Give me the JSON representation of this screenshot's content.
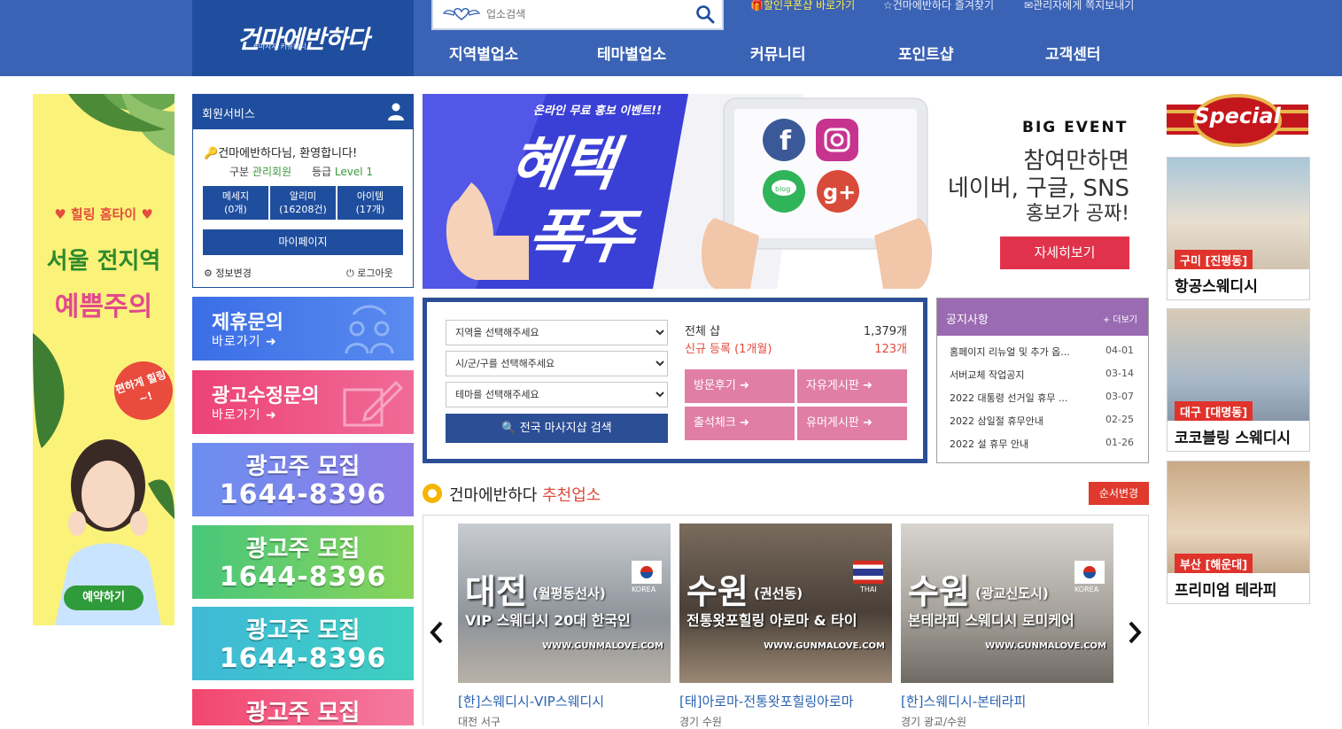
{
  "header": {
    "logo_text": "건마에반하다",
    "logo_sub": "#마사지 커뮤니티",
    "search_placeholder": "업소검색",
    "top_links": [
      "할인쿠폰샵 바로가기",
      "건마에반하다 즐겨찾기",
      "관리자에게 쪽지보내기"
    ],
    "nav": [
      "지역별업소",
      "테마별업소",
      "커뮤니티",
      "포인트샵",
      "고객센터"
    ]
  },
  "left_ad": {
    "line1": "♥ 힐링 홈타이 ♥",
    "line2": "서울 전지역",
    "line3": "예쁨주의",
    "bubble": "편하게 힐링~!",
    "button": "예약하기"
  },
  "member": {
    "title": "회원서비스",
    "welcome": "건마에반하다님, 환영합니다!",
    "grade_label": "구분",
    "grade_value": "관리회원",
    "level_label": "등급",
    "level_value": "Level 1",
    "stats": [
      {
        "label": "메세지",
        "value": "(0개)"
      },
      {
        "label": "알리미",
        "value": "(16208건)"
      },
      {
        "label": "아이템",
        "value": "(17개)"
      }
    ],
    "mypage": "마이페이지",
    "edit": "정보변경",
    "logout": "로그아웃"
  },
  "cta": [
    {
      "title": "제휴문의",
      "sub": "바로가기 ➜",
      "color": "#3c6fe0"
    },
    {
      "title": "광고수정문의",
      "sub": "바로가기 ➜",
      "color": "#ee4a82"
    }
  ],
  "recruit": [
    {
      "t1": "광고주 모집",
      "t2": "1644-8396"
    },
    {
      "t1": "광고주 모집",
      "t2": "1644-8396"
    },
    {
      "t1": "광고주 모집",
      "t2": "1644-8396"
    },
    {
      "t1": "광고주 모집",
      "t2": ""
    }
  ],
  "event": {
    "tag": "온라인 무료 홍보 이벤트!!",
    "big1": "혜택",
    "big2": "폭주",
    "head": "BIG EVENT",
    "l1": "참여만하면",
    "l2": "네이버, 구글, SNS",
    "l3": "홍보가 공짜!",
    "button": "자세히보기"
  },
  "search_panel": {
    "region": "지역을 선택해주세요",
    "city": "시/군/구를 선택해주세요",
    "theme": "테마를 선택해주세요",
    "button": "전국 마사지샵 검색",
    "total_label": "전체 샵",
    "total_value": "1,379개",
    "new_label": "신규 등록 (1개월)",
    "new_value": "123개",
    "buttons": [
      "방문후기",
      "자유게시판",
      "출석체크",
      "유머게시판"
    ]
  },
  "notice": {
    "title": "공지사항",
    "more": "+ 더보기",
    "rows": [
      {
        "title": "홈페이지 리뉴얼 및 추가 옵...",
        "date": "04-01"
      },
      {
        "title": "서버교체 작업공지",
        "date": "03-14"
      },
      {
        "title": "2022 대통령 선거일 휴무 ...",
        "date": "03-07"
      },
      {
        "title": "2022 삼일절 휴무안내",
        "date": "02-25"
      },
      {
        "title": "2022 설 휴무 안내",
        "date": "01-26"
      }
    ]
  },
  "recommend": {
    "title_prefix": "건마에반하다",
    "title_accent": "추천업소",
    "order_button": "순서변경",
    "cards": [
      {
        "city": "대전",
        "area": "(월평동선사)",
        "flag": "KOREA",
        "desc": "VIP 스웨디시 20대 한국인",
        "url": "WWW.GUNMALOVE.COM",
        "caption": "[한]스웨디시-VIP스웨디시",
        "caption2": "대전 서구"
      },
      {
        "city": "수원",
        "area": "(권선동)",
        "flag": "THAI",
        "desc": "전통왓포힐링 아로마 & 타이",
        "url": "WWW.GUNMALOVE.COM",
        "caption": "[태]아로마-전통왓포힐링아로마",
        "caption2": "경기 수원"
      },
      {
        "city": "수원",
        "area": "(광교신도시)",
        "flag": "KOREA",
        "desc": "본테라피 스웨디시 로미케어",
        "url": "WWW.GUNMALOVE.COM",
        "caption": "[한]스웨디시-본테라피",
        "caption2": "경기 광교/수원"
      }
    ]
  },
  "special": {
    "title": "Special",
    "items": [
      {
        "loc": "구미 [진평동]",
        "name": "항공스웨디시"
      },
      {
        "loc": "대구 [대명동]",
        "name": "코코블링 스웨디시"
      },
      {
        "loc": "부산 [해운대]",
        "name": "프리미엄 테라피"
      }
    ]
  }
}
